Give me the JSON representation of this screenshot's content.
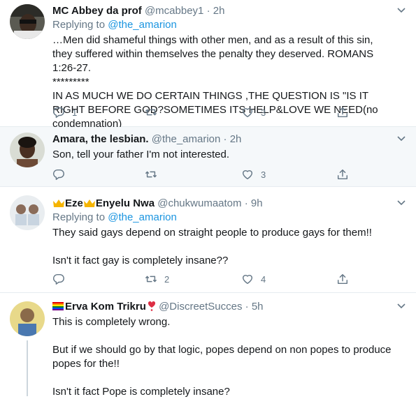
{
  "tweets": [
    {
      "name": "MC Abbey da prof",
      "handle": "@mcabbey1",
      "separator": "·",
      "time": "2h",
      "replying_prefix": "Replying to",
      "replying_to": "@the_amarion",
      "text": "…Men did shameful things with other men, and as a result of this sin, they suffered within themselves the penalty they deserved. ROMANS 1:26-27.\n*********\nIN AS MUCH WE DO CERTAIN THINGS ,THE QUESTION IS \"IS IT RIGHT BEFORE GOD?SOMETIMES ITS HELP&LOVE WE NEED(no condemnation)",
      "replies": "1",
      "retweets": "",
      "likes": "3"
    },
    {
      "name": "Amara, the lesbian.",
      "handle": "@the_amarion",
      "separator": "·",
      "time": "2h",
      "text": "Son, tell your father I'm not interested.",
      "replies": "",
      "retweets": "",
      "likes": "3"
    },
    {
      "name_part1": "Eze",
      "name_part2": "Enyelu Nwa",
      "handle": "@chukwumaatom",
      "separator": "·",
      "time": "9h",
      "replying_prefix": "Replying to",
      "replying_to": "@the_amarion",
      "text": "They said gays depend on straight people to produce gays for them!!\n\nIsn't it fact gay is completely insane??",
      "replies": "",
      "retweets": "2",
      "likes": "4"
    },
    {
      "name": "Erva Kom Trikru",
      "handle": "@DiscreetSucces",
      "separator": "·",
      "time": "5h",
      "text": "This is completely wrong.\n\nBut if we should go by that logic, popes depend on non popes to produce popes for the!!\n\nIsn't it fact Pope is completely insane?"
    }
  ]
}
